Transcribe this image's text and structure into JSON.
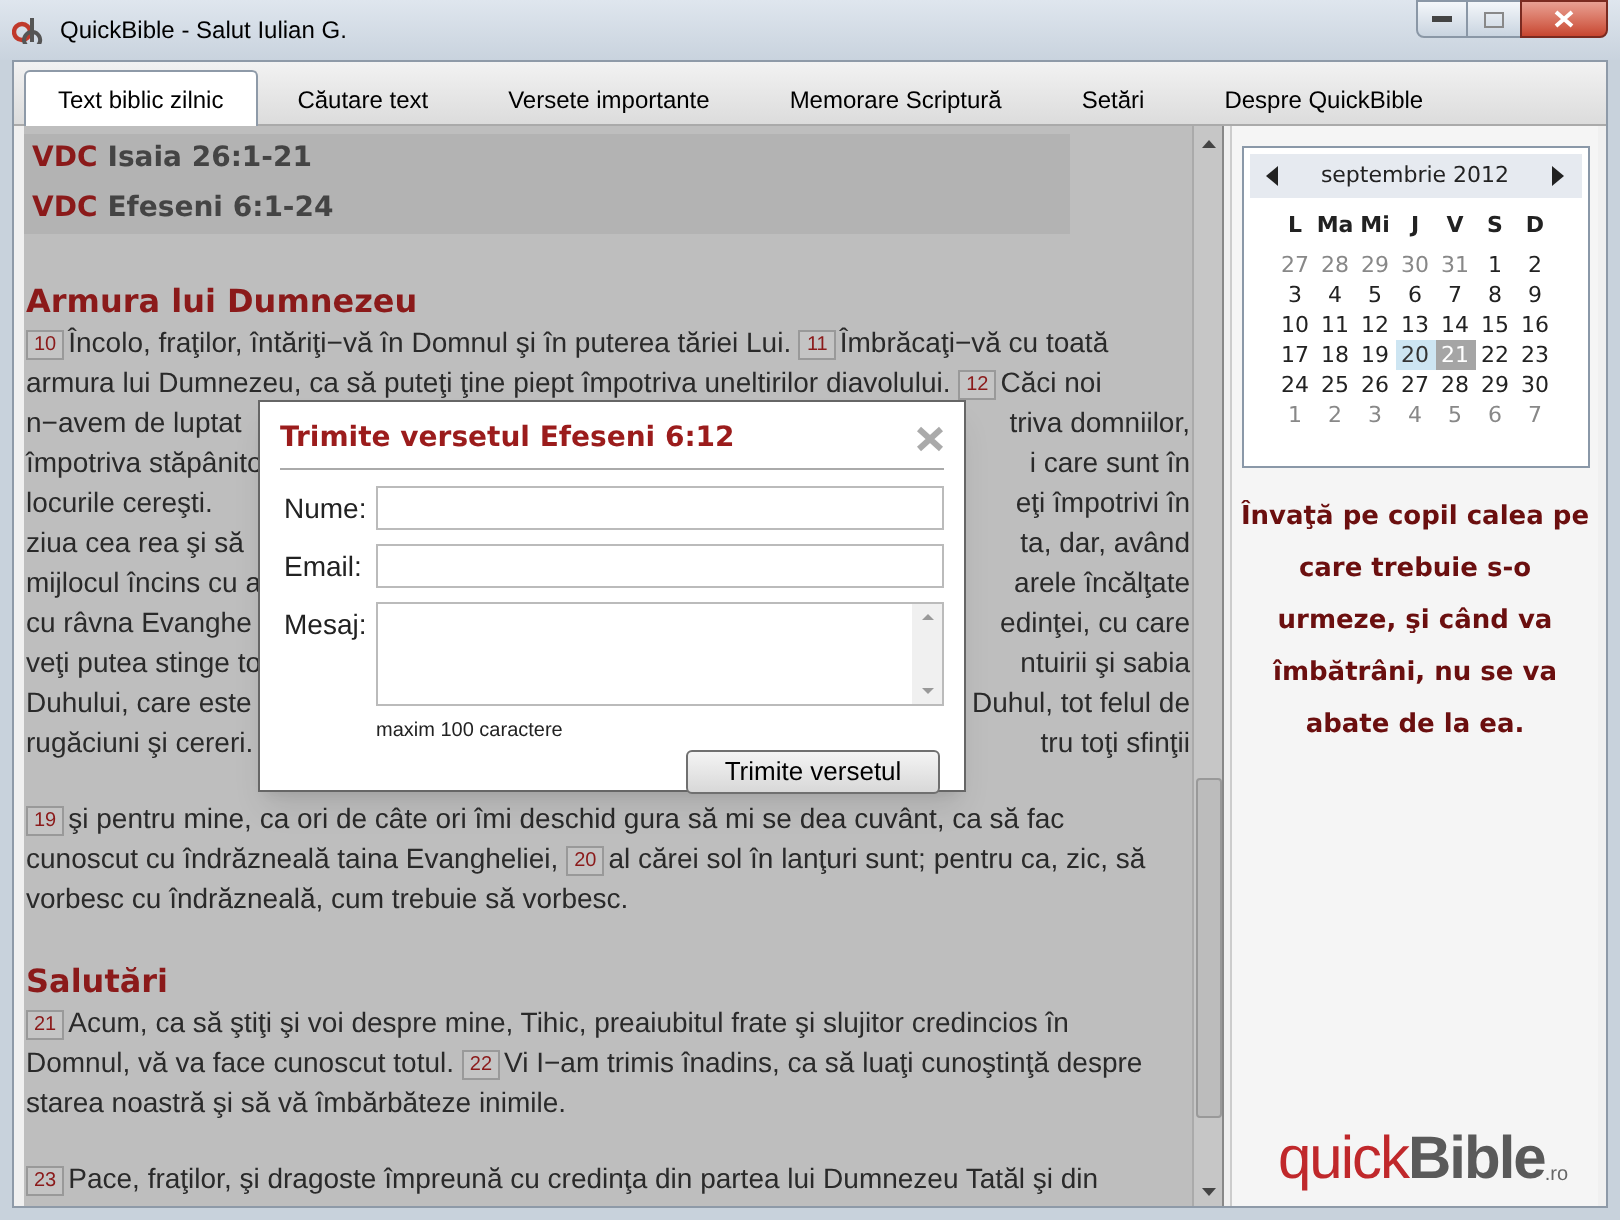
{
  "window": {
    "title": "QuickBible - Salut Iulian G."
  },
  "tabs": [
    {
      "label": "Text biblic zilnic",
      "selected": true
    },
    {
      "label": "Căutare text",
      "selected": false
    },
    {
      "label": "Versete importante",
      "selected": false
    },
    {
      "label": "Memorare Scriptură",
      "selected": false
    },
    {
      "label": "Setări",
      "selected": false
    },
    {
      "label": "Despre QuickBible",
      "selected": false
    }
  ],
  "readings": [
    {
      "tag": "VDC",
      "ref": "Isaia 26:1-21"
    },
    {
      "tag": "VDC",
      "ref": "Efeseni 6:1-24"
    }
  ],
  "passage": [
    {
      "heading": "Armura lui Dumnezeu",
      "paragraphs": [
        [
          {
            "left": [
              {
                "kind": "num",
                "text": "10"
              },
              {
                "kind": "text",
                "text": "Încolo, fraţilor, întăriţi−vă în Domnul şi în puterea tăriei Lui."
              },
              {
                "kind": "num",
                "text": "11"
              },
              {
                "kind": "text",
                "text": "Îmbrăcaţi−vă cu toată"
              }
            ]
          },
          {
            "left": [
              {
                "kind": "text",
                "text": "armura lui Dumnezeu, ca să puteţi ţine piept împotriva uneltirilor diavolului."
              },
              {
                "kind": "num",
                "text": "12"
              },
              {
                "kind": "text",
                "text": "Căci noi"
              }
            ]
          },
          {
            "left": [
              {
                "kind": "text",
                "text": "n−avem de luptat"
              }
            ],
            "right": [
              {
                "kind": "text",
                "text": "triva domniilor,"
              }
            ]
          },
          {
            "left": [
              {
                "kind": "text",
                "text": "împotriva stăpânito"
              }
            ],
            "right": [
              {
                "kind": "text",
                "text": "i care sunt în"
              }
            ]
          },
          {
            "left": [
              {
                "kind": "text",
                "text": "locurile cereşti."
              }
            ],
            "right": [
              {
                "kind": "text",
                "text": "eţi împotrivi în"
              }
            ]
          },
          {
            "left": [
              {
                "kind": "text",
                "text": "ziua cea rea şi să"
              }
            ],
            "right": [
              {
                "kind": "text",
                "text": "ta, dar, având"
              }
            ]
          },
          {
            "left": [
              {
                "kind": "text",
                "text": "mijlocul încins cu a"
              }
            ],
            "right": [
              {
                "kind": "text",
                "text": "arele încălţate"
              }
            ]
          },
          {
            "left": [
              {
                "kind": "text",
                "text": "cu râvna Evanghe"
              }
            ],
            "right": [
              {
                "kind": "text",
                "text": "edinţei, cu care"
              }
            ]
          },
          {
            "left": [
              {
                "kind": "text",
                "text": "veţi putea stinge to"
              }
            ],
            "right": [
              {
                "kind": "text",
                "text": "ntuirii şi sabia"
              }
            ]
          },
          {
            "left": [
              {
                "kind": "text",
                "text": "Duhului, care este"
              }
            ],
            "right": [
              {
                "kind": "text",
                "text": "Duhul, tot felul de"
              }
            ]
          },
          {
            "left": [
              {
                "kind": "text",
                "text": "rugăciuni şi cereri."
              }
            ],
            "right": [
              {
                "kind": "text",
                "text": "tru toţi sfinţii"
              }
            ]
          }
        ],
        [
          {
            "left": [
              {
                "kind": "num",
                "text": "19"
              },
              {
                "kind": "text",
                "text": "şi pentru mine, ca ori de câte ori îmi deschid gura să mi se dea cuvânt, ca să fac"
              }
            ]
          },
          {
            "left": [
              {
                "kind": "text",
                "text": "cunoscut cu îndrăzneală taina Evangheliei,"
              },
              {
                "kind": "num",
                "text": "20"
              },
              {
                "kind": "text",
                "text": "al cărei sol în lanţuri sunt; pentru ca, zic, să"
              }
            ]
          },
          {
            "left": [
              {
                "kind": "text",
                "text": "vorbesc cu îndrăzneală, cum trebuie să vorbesc."
              }
            ]
          }
        ]
      ]
    },
    {
      "heading": "Salutări",
      "paragraphs": [
        [
          {
            "left": [
              {
                "kind": "num",
                "text": "21"
              },
              {
                "kind": "text",
                "text": "Acum, ca să ştiţi şi voi despre mine, Tihic, preaiubitul frate şi slujitor credincios în"
              }
            ]
          },
          {
            "left": [
              {
                "kind": "text",
                "text": "Domnul, vă va face cunoscut totul."
              },
              {
                "kind": "num",
                "text": "22"
              },
              {
                "kind": "text",
                "text": "Vi I−am trimis înadins, ca să luaţi cunoştinţă despre"
              }
            ]
          },
          {
            "left": [
              {
                "kind": "text",
                "text": "starea noastră şi să vă îmbărbăteze inimile."
              }
            ]
          }
        ],
        [
          {
            "left": [
              {
                "kind": "num",
                "text": "23"
              },
              {
                "kind": "text",
                "text": "Pace, fraţilor, şi dragoste împreună cu credinţa din partea lui Dumnezeu Tatăl şi din"
              }
            ]
          }
        ]
      ]
    }
  ],
  "dialog": {
    "title": "Trimite versetul Efeseni 6:12",
    "fields": [
      {
        "label": "Nume:",
        "kind": "input"
      },
      {
        "label": "Email:",
        "kind": "input"
      },
      {
        "label": "Mesaj:",
        "kind": "textarea"
      }
    ],
    "hint": "maxim 100 caractere",
    "button": "Trimite versetul"
  },
  "calendar": {
    "month": "septembrie 2012",
    "weekdays": [
      "L",
      "Ma",
      "Mi",
      "J",
      "V",
      "S",
      "D"
    ],
    "days": [
      {
        "d": "27",
        "other": true,
        "today": false,
        "selected": false
      },
      {
        "d": "28",
        "other": true,
        "today": false,
        "selected": false
      },
      {
        "d": "29",
        "other": true,
        "today": false,
        "selected": false
      },
      {
        "d": "30",
        "other": true,
        "today": false,
        "selected": false
      },
      {
        "d": "31",
        "other": true,
        "today": false,
        "selected": false
      },
      {
        "d": "1",
        "other": false,
        "today": false,
        "selected": false
      },
      {
        "d": "2",
        "other": false,
        "today": false,
        "selected": false
      },
      {
        "d": "3",
        "other": false,
        "today": false,
        "selected": false
      },
      {
        "d": "4",
        "other": false,
        "today": false,
        "selected": false
      },
      {
        "d": "5",
        "other": false,
        "today": false,
        "selected": false
      },
      {
        "d": "6",
        "other": false,
        "today": false,
        "selected": false
      },
      {
        "d": "7",
        "other": false,
        "today": false,
        "selected": false
      },
      {
        "d": "8",
        "other": false,
        "today": false,
        "selected": false
      },
      {
        "d": "9",
        "other": false,
        "today": false,
        "selected": false
      },
      {
        "d": "10",
        "other": false,
        "today": false,
        "selected": false
      },
      {
        "d": "11",
        "other": false,
        "today": false,
        "selected": false
      },
      {
        "d": "12",
        "other": false,
        "today": false,
        "selected": false
      },
      {
        "d": "13",
        "other": false,
        "today": false,
        "selected": false
      },
      {
        "d": "14",
        "other": false,
        "today": false,
        "selected": false
      },
      {
        "d": "15",
        "other": false,
        "today": false,
        "selected": false
      },
      {
        "d": "16",
        "other": false,
        "today": false,
        "selected": false
      },
      {
        "d": "17",
        "other": false,
        "today": false,
        "selected": false
      },
      {
        "d": "18",
        "other": false,
        "today": false,
        "selected": false
      },
      {
        "d": "19",
        "other": false,
        "today": false,
        "selected": false
      },
      {
        "d": "20",
        "other": false,
        "today": true,
        "selected": false
      },
      {
        "d": "21",
        "other": false,
        "today": false,
        "selected": true
      },
      {
        "d": "22",
        "other": false,
        "today": false,
        "selected": false
      },
      {
        "d": "23",
        "other": false,
        "today": false,
        "selected": false
      },
      {
        "d": "24",
        "other": false,
        "today": false,
        "selected": false
      },
      {
        "d": "25",
        "other": false,
        "today": false,
        "selected": false
      },
      {
        "d": "26",
        "other": false,
        "today": false,
        "selected": false
      },
      {
        "d": "27",
        "other": false,
        "today": false,
        "selected": false
      },
      {
        "d": "28",
        "other": false,
        "today": false,
        "selected": false
      },
      {
        "d": "29",
        "other": false,
        "today": false,
        "selected": false
      },
      {
        "d": "30",
        "other": false,
        "today": false,
        "selected": false
      },
      {
        "d": "1",
        "other": true,
        "today": false,
        "selected": false
      },
      {
        "d": "2",
        "other": true,
        "today": false,
        "selected": false
      },
      {
        "d": "3",
        "other": true,
        "today": false,
        "selected": false
      },
      {
        "d": "4",
        "other": true,
        "today": false,
        "selected": false
      },
      {
        "d": "5",
        "other": true,
        "today": false,
        "selected": false
      },
      {
        "d": "6",
        "other": true,
        "today": false,
        "selected": false
      },
      {
        "d": "7",
        "other": true,
        "today": false,
        "selected": false
      }
    ]
  },
  "quote": "Învaţă pe copil calea pe care trebuie s-o urmeze, şi când va îmbătrâni, nu se va abate de la ea.",
  "logo": {
    "part_1": "quick",
    "part_2": "Bible",
    "part_3": ".ro"
  }
}
